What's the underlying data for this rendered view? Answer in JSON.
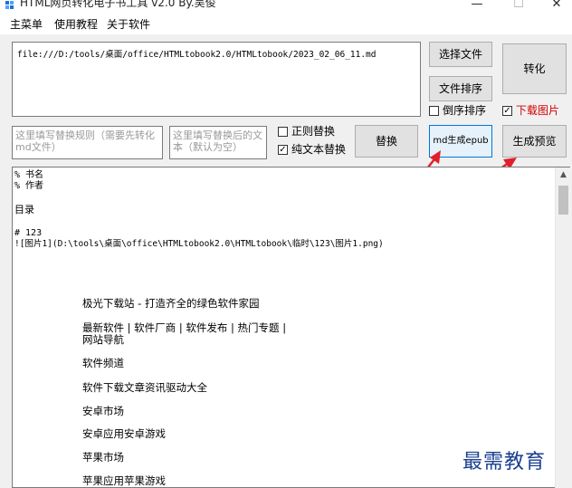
{
  "window": {
    "title": "HTML网页转化电子书工具 v2.0 By.吴俊",
    "minimize": "—",
    "maximize": "☐",
    "close": "✕"
  },
  "menu": [
    "主菜单",
    "使用教程",
    "关于软件"
  ],
  "path_field": {
    "value": "file:///D:/tools/桌面/office/HTMLtobook2.0/HTMLtobook/2023_02_06_11.md"
  },
  "buttons": {
    "select_file": "选择文件",
    "convert": "转化",
    "file_sort": "文件排序",
    "replace": "替换",
    "md_epub": "md生成epub",
    "preview": "生成预览"
  },
  "checkboxes": {
    "reverse_sort": {
      "label": "倒序排序",
      "checked": false
    },
    "download_images": {
      "label": "下载图片",
      "checked": true,
      "color": "#d40000"
    },
    "regex_replace": {
      "label": "正则替换",
      "checked": false
    },
    "plain_replace": {
      "label": "纯文本替换",
      "checked": true
    }
  },
  "rule_field": {
    "placeholder": "这里填写替换规则（需要先转化\nmd文件）"
  },
  "replace_field": {
    "placeholder": "这里填写替换后的文\n本（默认为空）"
  },
  "content": {
    "line1": "% 书名",
    "line2": "% 作者",
    "toc": "目录",
    "heading": "# 123",
    "image_line": "![图片1](D:\\tools\\桌面\\office\\HTMLtobook2.0\\HTMLtobook\\临时\\123\\图片1.png)",
    "items": [
      "极光下载站 - 打造齐全的绿色软件家园",
      "最新软件 | 软件厂商 | 软件发布 | 热门专题 |",
      "网站导航",
      "软件频道",
      "软件下载文章资讯驱动大全",
      "安卓市场",
      "安卓应用安卓游戏",
      "苹果市场",
      "苹果应用苹果游戏"
    ]
  },
  "watermark": "最需教育",
  "colors": {
    "arrow": "#e0202a",
    "highlight_border": "#0078d7",
    "highlight_bg": "#e5f1fb"
  }
}
